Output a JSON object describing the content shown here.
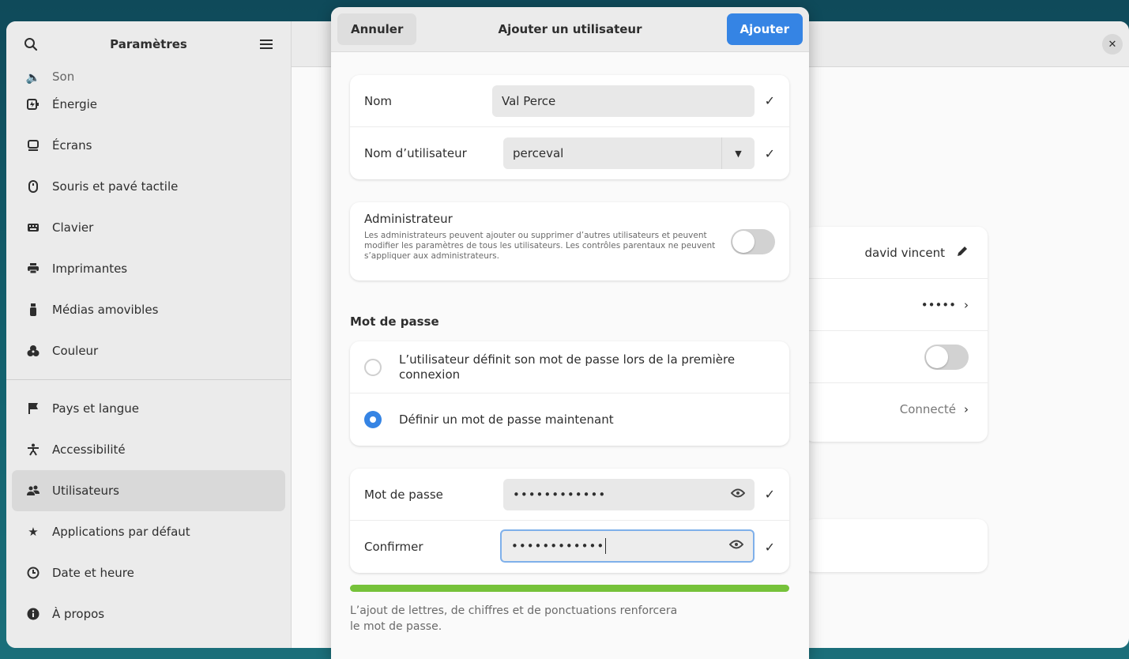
{
  "settings": {
    "title": "Paramètres",
    "sidebar_items": [
      {
        "label": "Son",
        "icon": "speaker-icon"
      },
      {
        "label": "Énergie",
        "icon": "battery-icon"
      },
      {
        "label": "Écrans",
        "icon": "display-icon"
      },
      {
        "label": "Souris et pavé tactile",
        "icon": "mouse-icon"
      },
      {
        "label": "Clavier",
        "icon": "keyboard-icon"
      },
      {
        "label": "Imprimantes",
        "icon": "printer-icon"
      },
      {
        "label": "Médias amovibles",
        "icon": "usb-icon"
      },
      {
        "label": "Couleur",
        "icon": "color-icon"
      },
      {
        "label": "Pays et langue",
        "icon": "flag-icon"
      },
      {
        "label": "Accessibilité",
        "icon": "accessibility-icon"
      },
      {
        "label": "Utilisateurs",
        "icon": "users-icon"
      },
      {
        "label": "Applications par défaut",
        "icon": "star-icon"
      },
      {
        "label": "Date et heure",
        "icon": "clock-icon"
      },
      {
        "label": "À propos",
        "icon": "info-icon"
      }
    ],
    "active_item": "Utilisateurs",
    "user_card": {
      "name": "david vincent",
      "password_mask": "•••••",
      "status": "Connecté"
    }
  },
  "dialog": {
    "title": "Ajouter un utilisateur",
    "cancel_label": "Annuler",
    "add_label": "Ajouter",
    "accent_color": "#3584e4",
    "name_label": "Nom",
    "name_value": "Val Perce",
    "username_label": "Nom d’utilisateur",
    "username_value": "perceval",
    "admin_title": "Administrateur",
    "admin_desc": "Les administrateurs peuvent ajouter ou supprimer d’autres utilisateurs et peuvent modifier les paramètres de tous les utilisateurs. Les contrôles parentaux ne peuvent s’appliquer aux administrateurs.",
    "admin_enabled": false,
    "password_section": "Mot de passe",
    "option_later": "L’utilisateur définit son mot de passe lors de la première connexion",
    "option_now": "Définir un mot de passe maintenant",
    "selected_option": "now",
    "password_label": "Mot de passe",
    "password_value": "••••••••••••",
    "confirm_label": "Confirmer",
    "confirm_value": "••••••••••••",
    "strength_level": 1.0,
    "strength_color": "#76c23a",
    "hint": "L’ajout de lettres, de chiffres et de ponctuations renforcera le mot de passe."
  }
}
